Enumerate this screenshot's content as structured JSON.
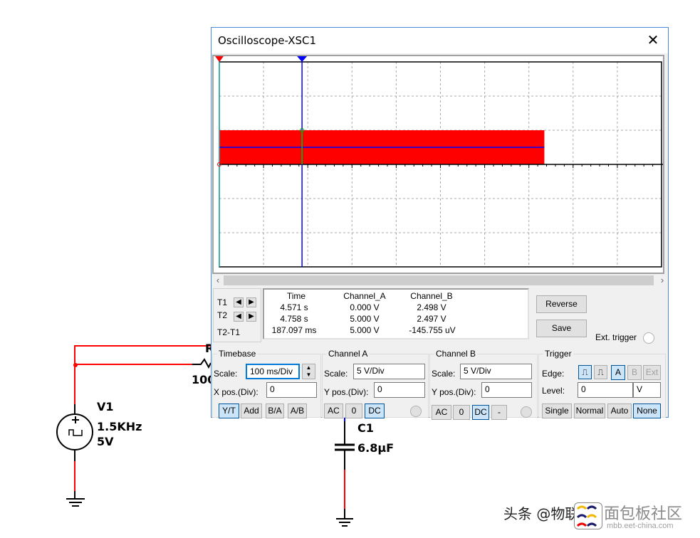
{
  "circuit": {
    "source": {
      "name": "V1",
      "frequency": "1.5KHz",
      "amplitude": "5V"
    },
    "resistor": {
      "name_partial": "R",
      "value_partial": "100"
    },
    "capacitor": {
      "name": "C1",
      "value": "6.8µF"
    },
    "wire_color": "#ff0000"
  },
  "window": {
    "title": "Oscilloscope-XSC1",
    "close_icon": "close-icon"
  },
  "display": {
    "grid": {
      "cols": 10,
      "rows": 6
    },
    "channel_a_color": "#ff0000",
    "channel_b_color": "#0000ff",
    "cursor_t1_color": "#00e0e0",
    "cursor_t2_color": "#0000ff",
    "chart_data": {
      "type": "line",
      "time_per_div_ms": 100,
      "volts_per_div": 5,
      "series": [
        {
          "name": "Channel_A",
          "description": "square wave 0 to 5 V, 1.5 kHz (appears as filled band)",
          "ymin": 0,
          "ymax": 5,
          "x_start_div": 0,
          "x_end_div": 7.35
        },
        {
          "name": "Channel_B",
          "value": 2.498,
          "x_start_div": 0,
          "x_end_div": 7.35
        }
      ],
      "cursors": {
        "T1_div": 0,
        "T2_div": 1.87
      }
    }
  },
  "readout": {
    "headers": [
      "Time",
      "Channel_A",
      "Channel_B"
    ],
    "rows": [
      {
        "label": "T1",
        "time": "4.571 s",
        "a": "0.000 V",
        "b": "2.498 V"
      },
      {
        "label": "T2",
        "time": "4.758 s",
        "a": "5.000 V",
        "b": "2.497 V"
      },
      {
        "label": "T2-T1",
        "time": "187.097 ms",
        "a": "5.000 V",
        "b": "-145.755 uV"
      }
    ]
  },
  "buttons": {
    "reverse": "Reverse",
    "save": "Save",
    "ext_trigger": "Ext. trigger"
  },
  "timebase": {
    "title": "Timebase",
    "scale_label": "Scale:",
    "scale": "100 ms/Div",
    "xpos_label": "X pos.(Div):",
    "xpos": "0",
    "modes": [
      "Y/T",
      "Add",
      "B/A",
      "A/B"
    ],
    "active": "Y/T"
  },
  "channel_a": {
    "title": "Channel A",
    "scale_label": "Scale:",
    "scale": "5  V/Div",
    "ypos_label": "Y pos.(Div):",
    "ypos": "0",
    "coupling": [
      "AC",
      "0",
      "DC"
    ],
    "active": "DC"
  },
  "channel_b": {
    "title": "Channel B",
    "scale_label": "Scale:",
    "scale": "5  V/Div",
    "ypos_label": "Y pos.(Div):",
    "ypos": "0",
    "coupling": [
      "AC",
      "0",
      "DC",
      "-"
    ],
    "active": "DC"
  },
  "trigger": {
    "title": "Trigger",
    "edge_label": "Edge:",
    "sources": [
      "A",
      "B",
      "Ext"
    ],
    "active_source": "A",
    "level_label": "Level:",
    "level": "0",
    "level_unit": "V",
    "modes": [
      "Single",
      "Normal",
      "Auto",
      "None"
    ],
    "active_mode": "None"
  },
  "watermark": {
    "text": "头条 @物联网",
    "logo": "面包板社区",
    "url": "mbb.eet-china.com"
  }
}
